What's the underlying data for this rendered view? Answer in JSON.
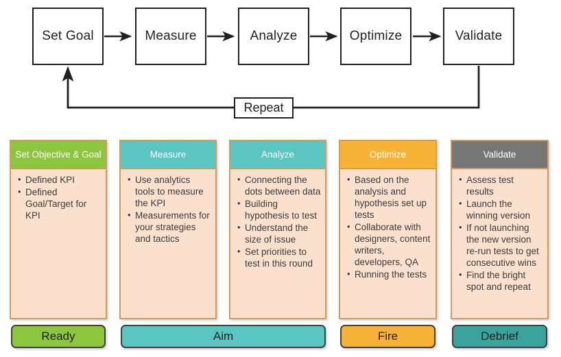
{
  "flowchart": {
    "steps": [
      {
        "label": "Set Goal"
      },
      {
        "label": "Measure"
      },
      {
        "label": "Analyze"
      },
      {
        "label": "Optimize"
      },
      {
        "label": "Validate"
      }
    ],
    "loop_label": "Repeat"
  },
  "cards": [
    {
      "title": "Set Objective  &\nGoal",
      "title_line1": "Set Objective  &",
      "title_line2": "Goal",
      "header_color": "#8CC63F",
      "bullets": [
        "Defined KPI",
        "Defined Goal/Target  for KPI"
      ]
    },
    {
      "title": "Measure",
      "header_color": "#5BC5C2",
      "bullets": [
        "Use analytics tools to measure the KPI",
        "Measurements for your strategies and tactics"
      ]
    },
    {
      "title": "Analyze",
      "header_color": "#5BC5C2",
      "bullets": [
        "Connecting the dots between data",
        "Building hypothesis to test",
        "Understand the size of issue",
        "Set priorities to test in this round"
      ]
    },
    {
      "title": "Optimize",
      "header_color": "#F7B335",
      "bullets": [
        "Based on the analysis and hypothesis set up tests",
        "Collaborate with designers, content writers, developers, QA",
        "Running the tests"
      ]
    },
    {
      "title": "Validate",
      "header_color": "#767676",
      "bullets": [
        "Assess test results",
        "Launch the winning version",
        "If not launching the new version re-run tests to get consecutive wins",
        "Find the bright spot and repeat"
      ]
    }
  ],
  "phases": [
    {
      "label": "Ready",
      "color": "#8CC63F"
    },
    {
      "label": "Aim",
      "color": "#5BC5C2"
    },
    {
      "label": "Fire",
      "color": "#F7B335"
    },
    {
      "label": "Debrief",
      "color": "#3AA39C"
    }
  ],
  "colors": {
    "card_body": "#FBE0CD",
    "card_border": "#D79A56",
    "line": "#231f20"
  }
}
